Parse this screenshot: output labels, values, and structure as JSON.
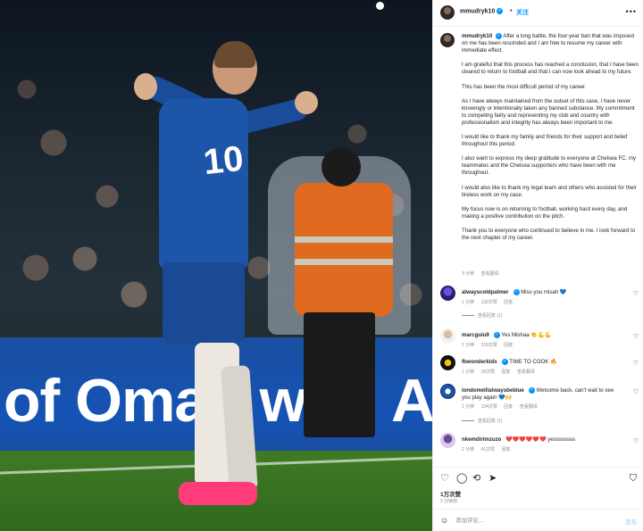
{
  "header": {
    "username": "mmudryk10",
    "dot": "•",
    "follow_label": "关注",
    "more_icon": "more-icon"
  },
  "photo": {
    "banner_text": "of Oman with Amar",
    "shirt_number": "10"
  },
  "caption": {
    "username": "mmudryk10",
    "paragraphs": [
      "After a long battle, the four-year ban that was imposed on me has been rescinded and I am free to resume my career with immediate effect.",
      "I am grateful that this process has reached a conclusion, that I have been cleared to return to football and that I can now look ahead to my future.",
      "This has been the most difficult period of my career.",
      "As I have always maintained from the outset of this case, I have never knowingly or intentionally taken any banned substance. My commitment to competing fairly and representing my club and country with professionalism and integrity has always been important to me.",
      "I would like to thank my family and friends for their support and belief throughout this period.",
      "I also want to express my deep gratitude to everyone at Chelsea FC, my teammates and the Chelsea supporters who have been with me throughout.",
      "I would also like to thank my legal team and others who assisted for their tireless work on my case.",
      "My focus now is on returning to football, working hard every day, and making a positive contribution on the pitch.",
      "Thank you to everyone who continued to believe in me. I look forward to the next chapter of my career."
    ],
    "time": "3 分钟",
    "translate": "查看翻译"
  },
  "comments": [
    {
      "username": "alwayscoldpalmer",
      "text": "Miss you misah 💙",
      "time": "1 分钟",
      "likes": "132次赞",
      "reply": "回复",
      "view_replies": "查看回复 (1)"
    },
    {
      "username": "marcguiu9",
      "text": "Yes Mishaa 👏💪💪",
      "time": "1 分钟",
      "likes": "218次赞",
      "reply": "回复",
      "view_replies": ""
    },
    {
      "username": "fbwonderkids",
      "text": "TIME TO COOK 🔥",
      "time": "1 分钟",
      "likes": "16次赞",
      "reply": "回复",
      "translate": "查看翻译",
      "view_replies": ""
    },
    {
      "username": "londonwillalwaysbeblue",
      "text": "Welcome back, can't wait to see you play again 💙🙌",
      "time": "1 分钟",
      "likes": "134次赞",
      "reply": "回复",
      "translate": "查看翻译",
      "view_replies": "查看回复 (1)"
    },
    {
      "username": "nkemdirimzuzo",
      "text": "❤️❤️❤️❤️❤️❤️ yessssssss",
      "time": "2 分钟",
      "likes": "41次赞",
      "reply": "回复",
      "view_replies": ""
    }
  ],
  "footer": {
    "likes": "1万次赞",
    "time": "3 分钟前",
    "comment_placeholder": "添加评论...",
    "post_label": "发布"
  },
  "colors": {
    "accent": "#0095f6",
    "meta_text": "#8e8e8e",
    "text": "#262626"
  }
}
